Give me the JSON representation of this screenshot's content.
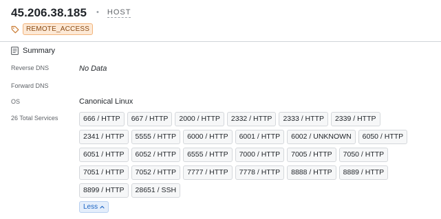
{
  "header": {
    "ip": "45.206.38.185",
    "separator": "•",
    "type_label": "HOST",
    "tag_icon": "tag-icon",
    "tag": "REMOTE_ACCESS"
  },
  "summary": {
    "icon": "document-list-icon",
    "title": "Summary",
    "reverse_dns": {
      "label": "Reverse DNS",
      "value": "No Data"
    },
    "forward_dns": {
      "label": "Forward DNS",
      "value": ""
    },
    "os": {
      "label": "OS",
      "value": "Canonical Linux"
    },
    "services_label": "26 Total Services",
    "services": [
      "666 / HTTP",
      "667 / HTTP",
      "2000 / HTTP",
      "2332 / HTTP",
      "2333 / HTTP",
      "2339 / HTTP",
      "2341 / HTTP",
      "5555 / HTTP",
      "6000 / HTTP",
      "6001 / HTTP",
      "6002 / UNKNOWN",
      "6050 / HTTP",
      "6051 / HTTP",
      "6052 / HTTP",
      "6555 / HTTP",
      "7000 / HTTP",
      "7005 / HTTP",
      "7050 / HTTP",
      "7051 / HTTP",
      "7052 / HTTP",
      "7777 / HTTP",
      "7778 / HTTP",
      "8888 / HTTP",
      "8889 / HTTP",
      "8899 / HTTP",
      "28651 / SSH"
    ],
    "less_label": "Less",
    "less_icon": "chevron-up-icon"
  }
}
